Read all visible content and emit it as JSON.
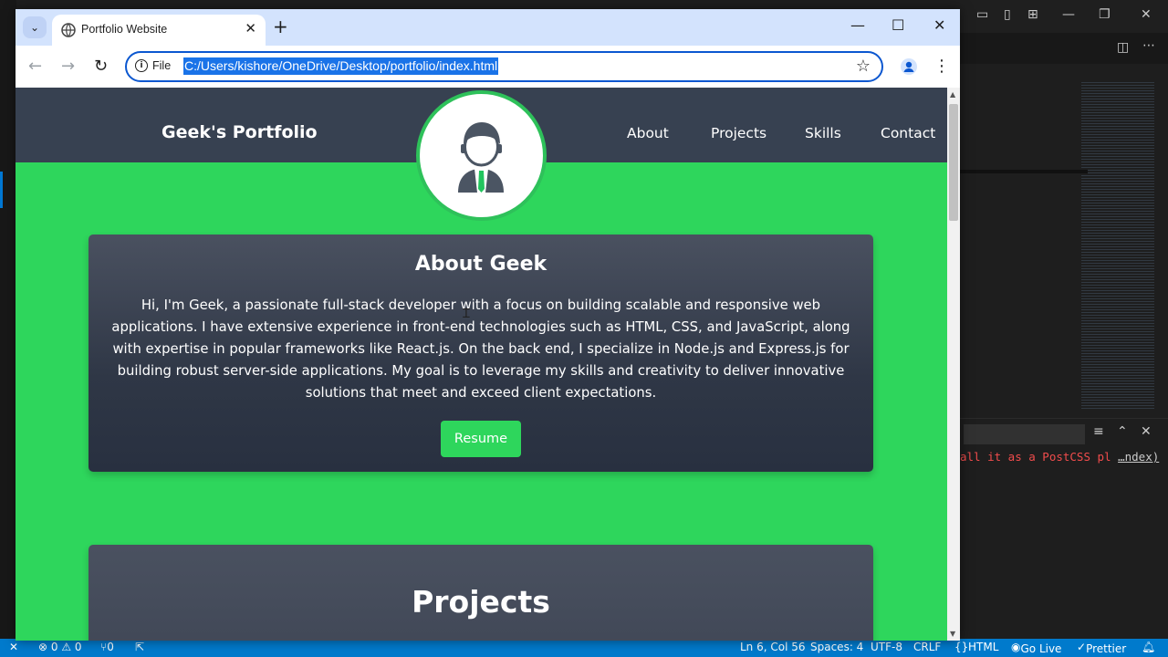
{
  "browser": {
    "tab_title": "Portfolio Website",
    "tab_list_icon": "chevron-down",
    "new_tab": "+",
    "window_controls": {
      "minimize": "—",
      "maximize": "☐",
      "close": "✕"
    },
    "address": {
      "scheme_label": "File",
      "url": "C:/Users/kishore/OneDrive/Desktop/portfolio/index.html"
    }
  },
  "site": {
    "brand": "Geek's Portfolio",
    "nav": [
      "About",
      "Projects",
      "Skills",
      "Contact"
    ],
    "about": {
      "title": "About Geek",
      "text": "Hi, I'm Geek, a passionate full-stack developer with a focus on building scalable and responsive web applications. I have extensive experience in front-end technologies such as HTML, CSS, and JavaScript, along with expertise in popular frameworks like React.js. On the back end, I specialize in Node.js and Express.js for building robust server-side applications. My goal is to leverage my skills and creativity to deliver innovative solutions that meet and exceed client expectations.",
      "button": "Resume"
    },
    "projects": {
      "title": "Projects"
    }
  },
  "editor": {
    "terminal_error": "all it as a PostCSS pl",
    "terminal_link": "…ndex)",
    "status": {
      "problems": "⊗ 0 ⚠ 0",
      "ports": "⑂0",
      "cursor": "Ln 6, Col 56",
      "spaces": "Spaces: 4",
      "encoding": "UTF-8",
      "eol": "CRLF",
      "language": "HTML",
      "golive": "Go Live",
      "prettier": "Prettier"
    }
  },
  "colors": {
    "page_green": "#2ed65c",
    "header_dark": "#374151",
    "accent_blue": "#0b57d0",
    "status_blue": "#007acc"
  }
}
